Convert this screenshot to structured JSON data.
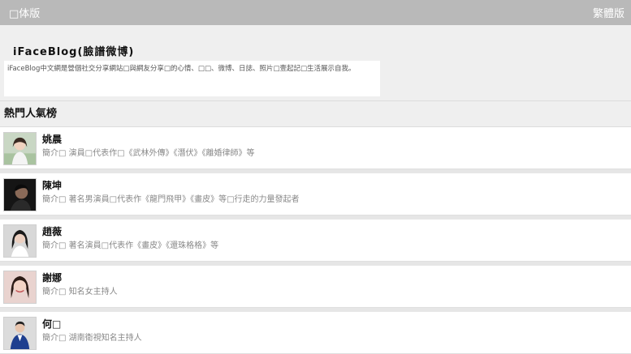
{
  "topbar": {
    "left_link": "□体版",
    "right_link": "繁體版"
  },
  "header": {
    "title": "iFaceBlog(臉譜微博)",
    "description": "iFaceBlog中文網是營個社交分享網站□與網友分享□的心情、□□、微博、日誌、照片□壹起記□生活展示自我。"
  },
  "section": {
    "title": "熱門人氣榜"
  },
  "people": [
    {
      "name": "姚晨",
      "intro": "簡介□ 演員□代表作□《武林外傳》《潛伏》《離婚律師》等"
    },
    {
      "name": "陳坤",
      "intro": "簡介□ 著名男演員□代表作《龍門飛甲》《畫皮》等□行走的力量發起者"
    },
    {
      "name": "趙薇",
      "intro": "簡介□ 著名演員□代表作《畫皮》《還珠格格》等"
    },
    {
      "name": "謝娜",
      "intro": "簡介□ 知名女主持人"
    },
    {
      "name": "何□",
      "intro": "簡介□ 湖南衛視知名主持人"
    }
  ],
  "colors": {
    "topbar": "#b9b9b9",
    "header_bg": "#efefef",
    "intro_text": "#888888"
  }
}
